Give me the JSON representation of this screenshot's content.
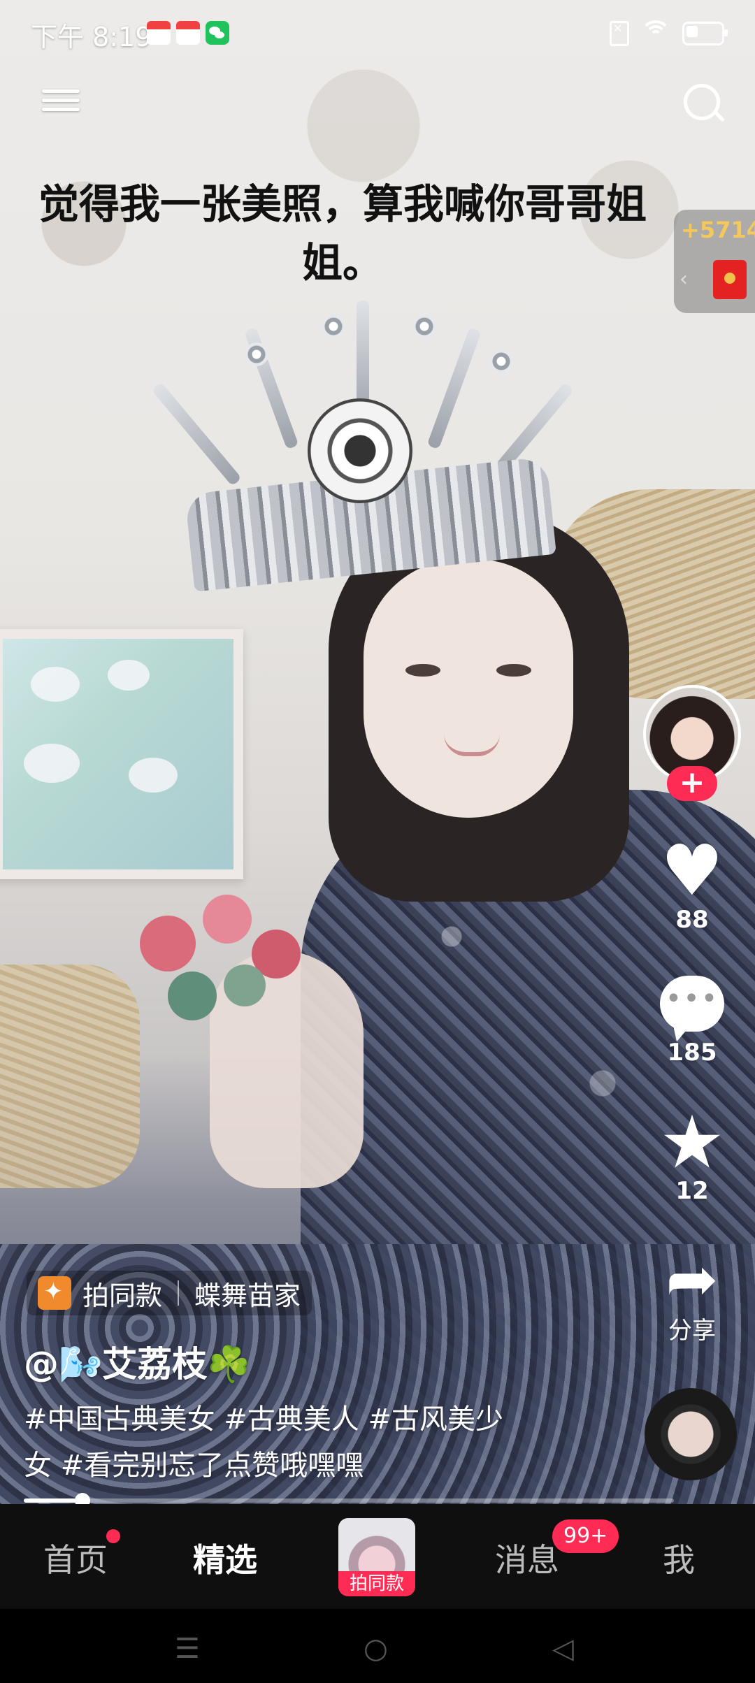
{
  "status_bar": {
    "time": "下午 8:19",
    "notification_icons": [
      "calendar-icon",
      "calendar-icon",
      "wechat-icon"
    ],
    "system_icons": [
      "no-sim-icon",
      "wifi-icon",
      "battery-icon"
    ]
  },
  "overlay": {
    "caption": "觉得我一张美照，算我喊你哥哥姐姐。"
  },
  "red_packet": {
    "amount": "+5714"
  },
  "actions": {
    "likes": "88",
    "comments": "185",
    "favorites": "12",
    "share_label": "分享"
  },
  "video_info": {
    "template_label": "拍同款",
    "template_name": "蝶舞苗家",
    "author": "@🌬️艾荔枝☘️",
    "description": "#中国古典美女 #古典美人 #古风美少女 #看完别忘了点赞哦嘿嘿",
    "progress": 0.09
  },
  "bottom_nav": {
    "items": [
      {
        "label": "首页",
        "active": false,
        "dot": true
      },
      {
        "label": "精选",
        "active": true
      },
      {
        "label": "消息",
        "badge": "99+"
      },
      {
        "label": "我"
      }
    ],
    "center_label": "拍同款"
  },
  "colors": {
    "accent": "#fe2c55",
    "nav_bg": "#0f0f0f"
  }
}
